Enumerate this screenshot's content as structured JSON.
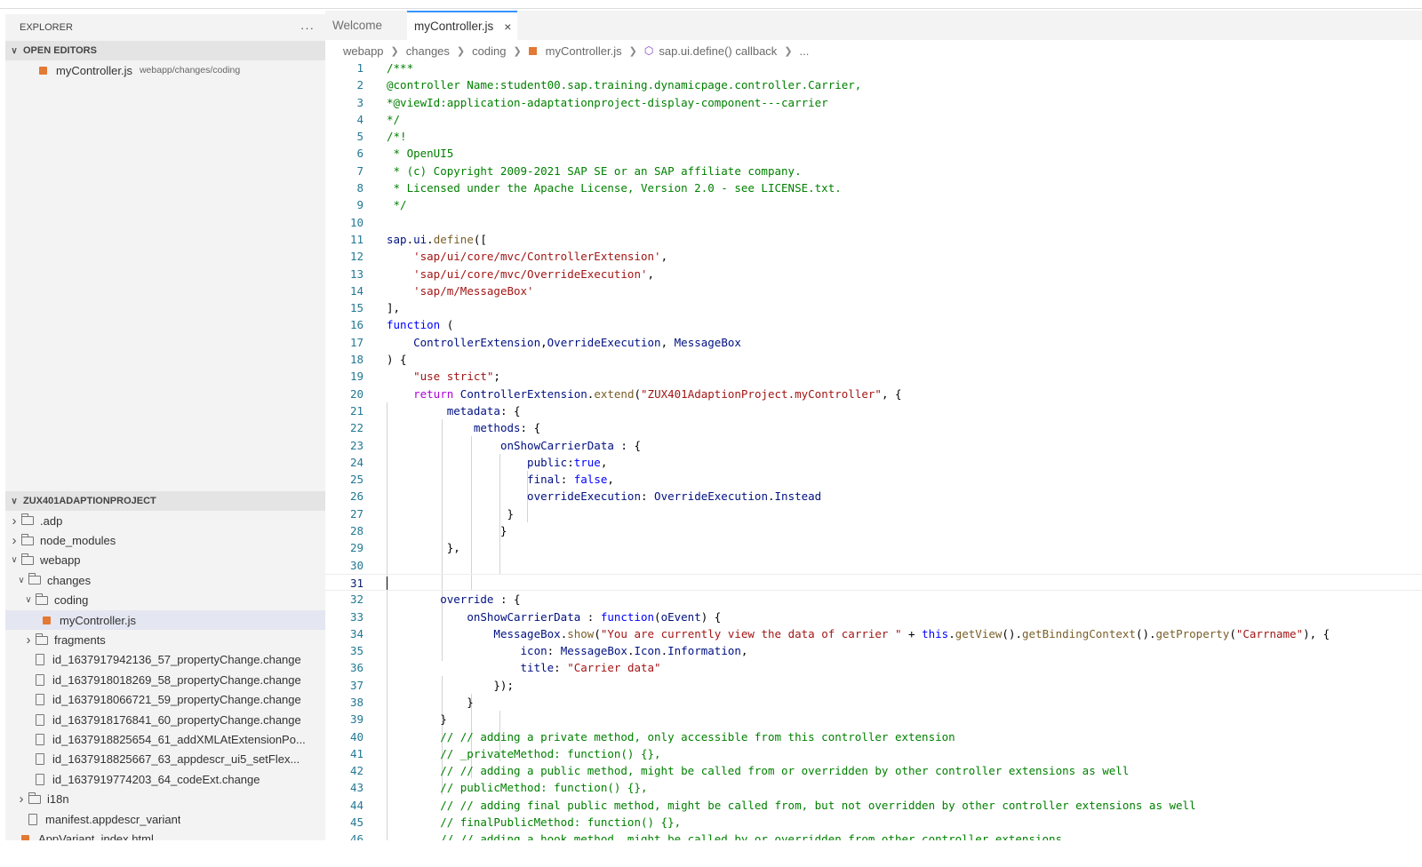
{
  "explorer": {
    "title": "EXPLORER",
    "more": "···"
  },
  "open_editors": {
    "header": "OPEN EDITORS",
    "items": [
      {
        "name": "myController.js",
        "path": "webapp/changes/coding"
      }
    ]
  },
  "project": {
    "header": "ZUX401ADAPTIONPROJECT",
    "tree": [
      {
        "label": ".adp",
        "indent": 0,
        "type": "folder",
        "state": "collapsed"
      },
      {
        "label": "node_modules",
        "indent": 0,
        "type": "folder",
        "state": "collapsed"
      },
      {
        "label": "webapp",
        "indent": 0,
        "type": "folder",
        "state": "expanded"
      },
      {
        "label": "changes",
        "indent": 1,
        "type": "folder",
        "state": "expanded"
      },
      {
        "label": "coding",
        "indent": 2,
        "type": "folder",
        "state": "expanded"
      },
      {
        "label": "myController.js",
        "indent": 3,
        "type": "js",
        "state": "",
        "selected": true
      },
      {
        "label": "fragments",
        "indent": 2,
        "type": "folder",
        "state": "collapsed"
      },
      {
        "label": "id_1637917942136_57_propertyChange.change",
        "indent": 2,
        "type": "file",
        "state": ""
      },
      {
        "label": "id_1637918018269_58_propertyChange.change",
        "indent": 2,
        "type": "file",
        "state": ""
      },
      {
        "label": "id_1637918066721_59_propertyChange.change",
        "indent": 2,
        "type": "file",
        "state": ""
      },
      {
        "label": "id_1637918176841_60_propertyChange.change",
        "indent": 2,
        "type": "file",
        "state": ""
      },
      {
        "label": "id_1637918825654_61_addXMLAtExtensionPo...",
        "indent": 2,
        "type": "file",
        "state": ""
      },
      {
        "label": "id_1637918825667_63_appdescr_ui5_setFlex...",
        "indent": 2,
        "type": "file",
        "state": ""
      },
      {
        "label": "id_1637919774203_64_codeExt.change",
        "indent": 2,
        "type": "file",
        "state": ""
      },
      {
        "label": "i18n",
        "indent": 1,
        "type": "folder",
        "state": "collapsed"
      },
      {
        "label": "manifest.appdescr_variant",
        "indent": 1,
        "type": "file",
        "state": ""
      },
      {
        "label": "AppVariant_index.html",
        "indent": 0,
        "type": "js",
        "state": ""
      }
    ]
  },
  "tabs": [
    {
      "label": "Welcome",
      "active": false
    },
    {
      "label": "myController.js",
      "active": true,
      "close": "×"
    }
  ],
  "breadcrumb": [
    "webapp",
    "changes",
    "coding",
    "myController.js",
    "sap.ui.define() callback",
    "..."
  ],
  "editor": {
    "cursor_line": 31,
    "lines": [
      [
        [
          "c-com",
          "/***"
        ]
      ],
      [
        [
          "c-com",
          "@controller Name:student00.sap.training.dynamicpage.controller.Carrier,"
        ]
      ],
      [
        [
          "c-com",
          "*@viewId:application-adaptationproject-display-component---carrier"
        ]
      ],
      [
        [
          "c-com",
          "*/"
        ]
      ],
      [
        [
          "c-com",
          "/*!"
        ]
      ],
      [
        [
          "c-com",
          " * OpenUI5"
        ]
      ],
      [
        [
          "c-com",
          " * (c) Copyright 2009-2021 SAP SE or an SAP affiliate company."
        ]
      ],
      [
        [
          "c-com",
          " * Licensed under the Apache License, Version 2.0 - see LICENSE.txt."
        ]
      ],
      [
        [
          "c-com",
          " */"
        ]
      ],
      [],
      [
        [
          "c-var",
          "sap"
        ],
        [
          "c-pl",
          "."
        ],
        [
          "c-var",
          "ui"
        ],
        [
          "c-pl",
          "."
        ],
        [
          "c-fn",
          "define"
        ],
        [
          "c-pl",
          "(["
        ]
      ],
      [
        [
          "c-pl",
          "    "
        ],
        [
          "c-str",
          "'sap/ui/core/mvc/ControllerExtension'"
        ],
        [
          "c-pl",
          ","
        ]
      ],
      [
        [
          "c-pl",
          "    "
        ],
        [
          "c-str",
          "'sap/ui/core/mvc/OverrideExecution'"
        ],
        [
          "c-pl",
          ","
        ]
      ],
      [
        [
          "c-pl",
          "    "
        ],
        [
          "c-str",
          "'sap/m/MessageBox'"
        ]
      ],
      [
        [
          "c-pl",
          "],"
        ]
      ],
      [
        [
          "c-kw",
          "function"
        ],
        [
          "c-pl",
          " ("
        ]
      ],
      [
        [
          "c-pl",
          "    "
        ],
        [
          "c-var",
          "ControllerExtension"
        ],
        [
          "c-pl",
          ","
        ],
        [
          "c-var",
          "OverrideExecution"
        ],
        [
          "c-pl",
          ", "
        ],
        [
          "c-var",
          "MessageBox"
        ]
      ],
      [
        [
          "c-pl",
          ") {"
        ]
      ],
      [
        [
          "c-pl",
          "    "
        ],
        [
          "c-str",
          "\"use strict\""
        ],
        [
          "c-pl",
          ";"
        ]
      ],
      [
        [
          "c-pl",
          "    "
        ],
        [
          "c-ctl",
          "return"
        ],
        [
          "c-pl",
          " "
        ],
        [
          "c-var",
          "ControllerExtension"
        ],
        [
          "c-pl",
          "."
        ],
        [
          "c-fn",
          "extend"
        ],
        [
          "c-pl",
          "("
        ],
        [
          "c-str",
          "\"ZUX401AdaptionProject.myController\""
        ],
        [
          "c-pl",
          ", {"
        ]
      ],
      [
        [
          "c-pl",
          "         "
        ],
        [
          "c-var",
          "metadata"
        ],
        [
          "c-pl",
          ": {"
        ]
      ],
      [
        [
          "c-pl",
          "             "
        ],
        [
          "c-var",
          "methods"
        ],
        [
          "c-pl",
          ": {"
        ]
      ],
      [
        [
          "c-pl",
          "                 "
        ],
        [
          "c-var",
          "onShowCarrierData"
        ],
        [
          "c-pl",
          " : {"
        ]
      ],
      [
        [
          "c-pl",
          "                     "
        ],
        [
          "c-var",
          "public"
        ],
        [
          "c-pl",
          ":"
        ],
        [
          "c-kw",
          "true"
        ],
        [
          "c-pl",
          ","
        ]
      ],
      [
        [
          "c-pl",
          "                     "
        ],
        [
          "c-var",
          "final"
        ],
        [
          "c-pl",
          ": "
        ],
        [
          "c-kw",
          "false"
        ],
        [
          "c-pl",
          ","
        ]
      ],
      [
        [
          "c-pl",
          "                     "
        ],
        [
          "c-var",
          "overrideExecution"
        ],
        [
          "c-pl",
          ": "
        ],
        [
          "c-var",
          "OverrideExecution"
        ],
        [
          "c-pl",
          "."
        ],
        [
          "c-var",
          "Instead"
        ]
      ],
      [
        [
          "c-pl",
          "                  }"
        ]
      ],
      [
        [
          "c-pl",
          "                 }"
        ]
      ],
      [
        [
          "c-pl",
          "         },"
        ]
      ],
      [],
      [],
      [
        [
          "c-pl",
          "        "
        ],
        [
          "c-var",
          "override"
        ],
        [
          "c-pl",
          " : {"
        ]
      ],
      [
        [
          "c-pl",
          "            "
        ],
        [
          "c-var",
          "onShowCarrierData"
        ],
        [
          "c-pl",
          " : "
        ],
        [
          "c-kw",
          "function"
        ],
        [
          "c-pl",
          "("
        ],
        [
          "c-var",
          "oEvent"
        ],
        [
          "c-pl",
          ") {"
        ]
      ],
      [
        [
          "c-pl",
          "                "
        ],
        [
          "c-var",
          "MessageBox"
        ],
        [
          "c-pl",
          "."
        ],
        [
          "c-fn",
          "show"
        ],
        [
          "c-pl",
          "("
        ],
        [
          "c-str",
          "\"You are currently view the data of carrier \""
        ],
        [
          "c-pl",
          " + "
        ],
        [
          "c-kw",
          "this"
        ],
        [
          "c-pl",
          "."
        ],
        [
          "c-fn",
          "getView"
        ],
        [
          "c-pl",
          "()."
        ],
        [
          "c-fn",
          "getBindingContext"
        ],
        [
          "c-pl",
          "()."
        ],
        [
          "c-fn",
          "getProperty"
        ],
        [
          "c-pl",
          "("
        ],
        [
          "c-str",
          "\"Carrname\""
        ],
        [
          "c-pl",
          "), {"
        ]
      ],
      [
        [
          "c-pl",
          "                    "
        ],
        [
          "c-var",
          "icon"
        ],
        [
          "c-pl",
          ": "
        ],
        [
          "c-var",
          "MessageBox"
        ],
        [
          "c-pl",
          "."
        ],
        [
          "c-var",
          "Icon"
        ],
        [
          "c-pl",
          "."
        ],
        [
          "c-var",
          "Information"
        ],
        [
          "c-pl",
          ","
        ]
      ],
      [
        [
          "c-pl",
          "                    "
        ],
        [
          "c-var",
          "title"
        ],
        [
          "c-pl",
          ": "
        ],
        [
          "c-str",
          "\"Carrier data\""
        ]
      ],
      [
        [
          "c-pl",
          "                });"
        ]
      ],
      [
        [
          "c-pl",
          "            }"
        ]
      ],
      [
        [
          "c-pl",
          "        }"
        ]
      ],
      [
        [
          "c-com",
          "        // // adding a private method, only accessible from this controller extension"
        ]
      ],
      [
        [
          "c-com",
          "        // _privateMethod: function() {},"
        ]
      ],
      [
        [
          "c-com",
          "        // // adding a public method, might be called from or overridden by other controller extensions as well"
        ]
      ],
      [
        [
          "c-com",
          "        // publicMethod: function() {},"
        ]
      ],
      [
        [
          "c-com",
          "        // // adding final public method, might be called from, but not overridden by other controller extensions as well"
        ]
      ],
      [
        [
          "c-com",
          "        // finalPublicMethod: function() {},"
        ]
      ],
      [
        [
          "c-com",
          "        // // adding a hook method, might be called by or overridden from other controller extensions"
        ]
      ]
    ]
  }
}
